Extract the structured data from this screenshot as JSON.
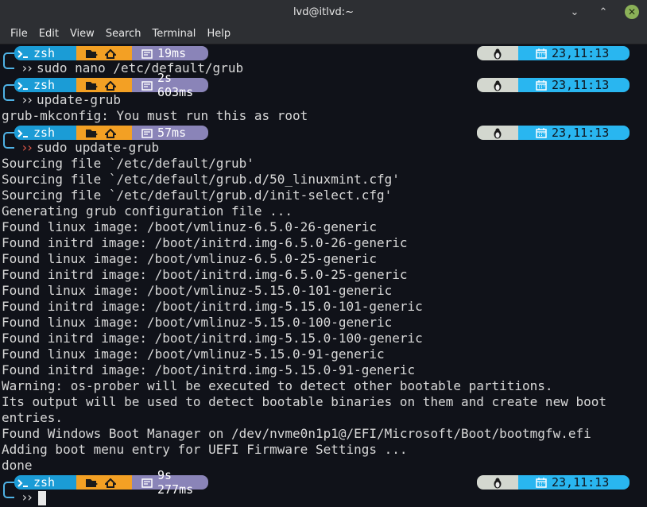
{
  "window": {
    "title": "lvd@itlvd:~",
    "minimize_glyph": "⌄",
    "maximize_glyph": "⌃",
    "close_glyph": "✕"
  },
  "menu": [
    "File",
    "Edit",
    "View",
    "Search",
    "Terminal",
    "Help"
  ],
  "prompts": [
    {
      "shell": "zsh",
      "duration": "19ms",
      "time": "23,11:13",
      "command": "sudo nano /etc/default/grub",
      "error": false
    },
    {
      "shell": "zsh",
      "duration": "2s 603ms",
      "time": "23,11:13",
      "command": "update-grub",
      "error": false
    },
    {
      "shell": "zsh",
      "duration": "57ms",
      "time": "23,11:13",
      "command": "sudo update-grub",
      "error": true
    },
    {
      "shell": "zsh",
      "duration": "9s 277ms",
      "time": "23,11:13",
      "command": "",
      "error": false
    }
  ],
  "output": {
    "after_update_grub": [
      "grub-mkconfig: You must run this as root"
    ],
    "after_sudo_update_grub": [
      "Sourcing file `/etc/default/grub'",
      "Sourcing file `/etc/default/grub.d/50_linuxmint.cfg'",
      "Sourcing file `/etc/default/grub.d/init-select.cfg'",
      "Generating grub configuration file ...",
      "Found linux image: /boot/vmlinuz-6.5.0-26-generic",
      "Found initrd image: /boot/initrd.img-6.5.0-26-generic",
      "Found linux image: /boot/vmlinuz-6.5.0-25-generic",
      "Found initrd image: /boot/initrd.img-6.5.0-25-generic",
      "Found linux image: /boot/vmlinuz-5.15.0-101-generic",
      "Found initrd image: /boot/initrd.img-5.15.0-101-generic",
      "Found linux image: /boot/vmlinuz-5.15.0-100-generic",
      "Found initrd image: /boot/initrd.img-5.15.0-100-generic",
      "Found linux image: /boot/vmlinuz-5.15.0-91-generic",
      "Found initrd image: /boot/initrd.img-5.15.0-91-generic",
      "Warning: os-prober will be executed to detect other bootable partitions.",
      "Its output will be used to detect bootable binaries on them and create new boot",
      "entries.",
      "Found Windows Boot Manager on /dev/nvme0n1p1@/EFI/Microsoft/Boot/bootmgfw.efi",
      "Adding boot menu entry for UEFI Firmware Settings ...",
      "done"
    ]
  },
  "colors": {
    "terminal_bg": "#101219",
    "shell_segment": "#1b9cd6",
    "dir_segment": "#f3a024",
    "duration_segment": "#8a84b8",
    "os_segment": "#d3d7cf",
    "clock_segment": "#29b6f0",
    "error_chevron": "#e0584a"
  },
  "icons": {
    "shell": "terminal-prompt-icon",
    "folder": "folder-icon",
    "home": "home-icon",
    "timer": "timer-icon",
    "os": "linux-tux-icon",
    "calendar": "calendar-icon"
  }
}
